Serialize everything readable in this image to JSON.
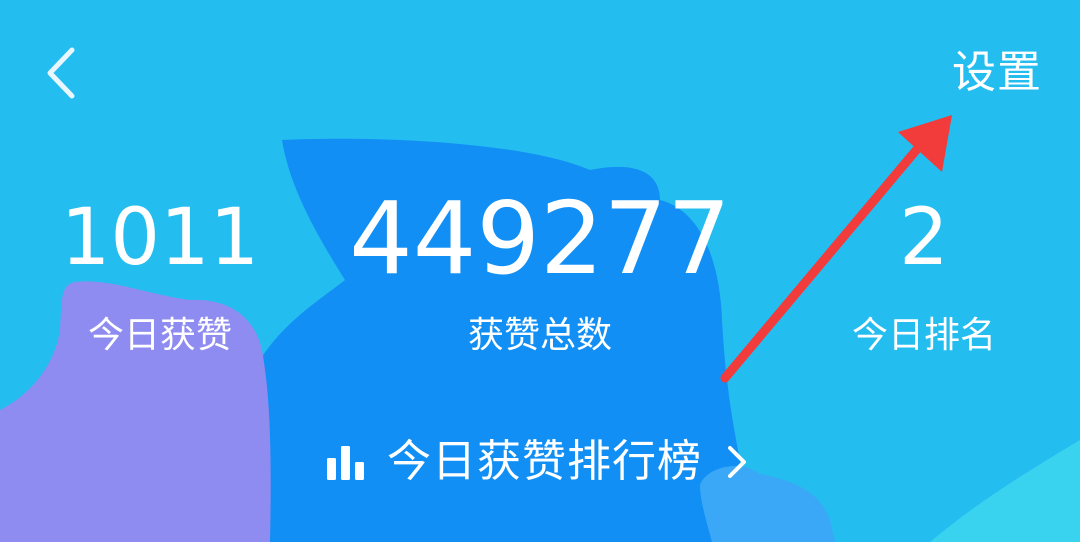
{
  "header": {
    "back_icon": "chevron-left-icon",
    "settings_label": "设置"
  },
  "stats": {
    "today_likes": {
      "value": "1011",
      "label": "今日获赞"
    },
    "total_likes": {
      "value": "449277",
      "label": "获赞总数"
    },
    "today_rank": {
      "value": "2",
      "label": "今日排名"
    }
  },
  "leaderboard_link": {
    "icon": "bar-chart-icon",
    "label": "今日获赞排行榜",
    "chevron_icon": "chevron-right-icon"
  },
  "colors": {
    "background": "#24bdf0",
    "thumb_dark": "#118ff5",
    "thumb_purple": "#8e8cf0",
    "annotation_arrow": "#f23b3b",
    "text": "#ffffff"
  }
}
